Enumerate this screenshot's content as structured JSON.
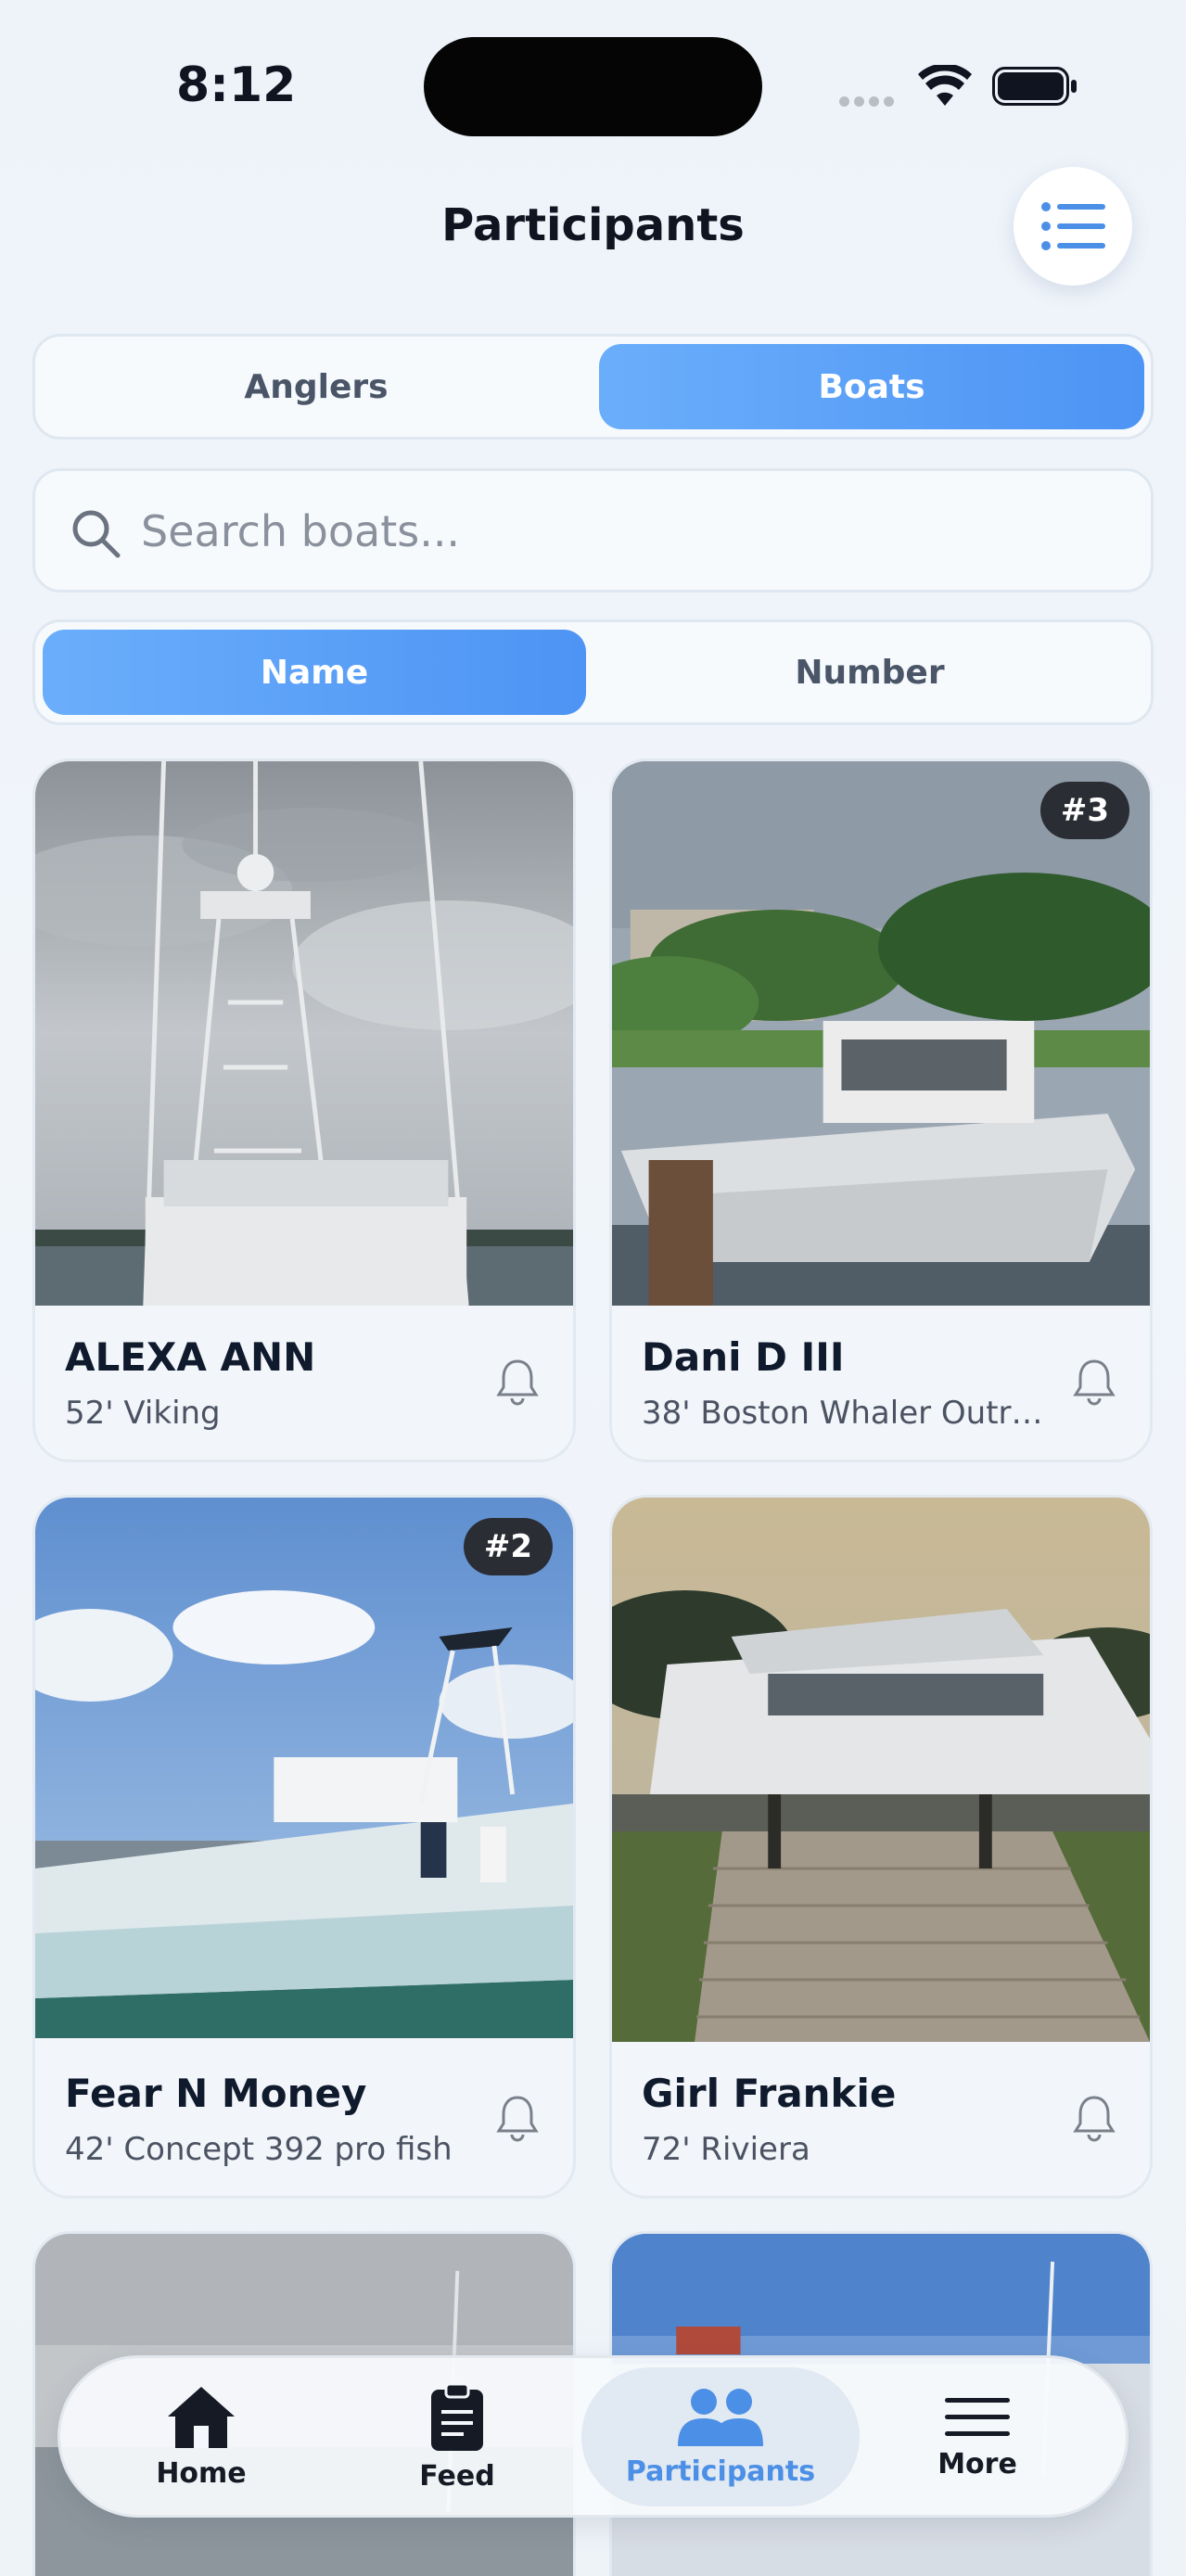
{
  "status_bar": {
    "time": "8:12"
  },
  "header": {
    "title": "Participants"
  },
  "view_toggle": {
    "options": [
      "Anglers",
      "Boats"
    ],
    "selected": "Boats"
  },
  "search": {
    "placeholder": "Search boats..."
  },
  "sort_toggle": {
    "options": [
      "Name",
      "Number"
    ],
    "selected": "Name"
  },
  "boats": [
    {
      "name": "ALEXA ANN",
      "description": "52' Viking",
      "badge": ""
    },
    {
      "name": "Dani D III",
      "description": "38' Boston Whaler Outr…",
      "badge": "#3"
    },
    {
      "name": "Fear N Money",
      "description": "42' Concept 392 pro fish",
      "badge": "#2"
    },
    {
      "name": "Girl Frankie",
      "description": "72' Riviera",
      "badge": ""
    }
  ],
  "tab_bar": {
    "items": [
      {
        "label": "Home",
        "icon": "home-icon"
      },
      {
        "label": "Feed",
        "icon": "clipboard-icon"
      },
      {
        "label": "Participants",
        "icon": "people-icon"
      },
      {
        "label": "More",
        "icon": "menu-icon"
      }
    ],
    "active": "Participants"
  },
  "colors": {
    "accent": "#5a9ef7",
    "active_tab_text": "#4b8fe6",
    "badge_bg": "#2a2d33"
  }
}
